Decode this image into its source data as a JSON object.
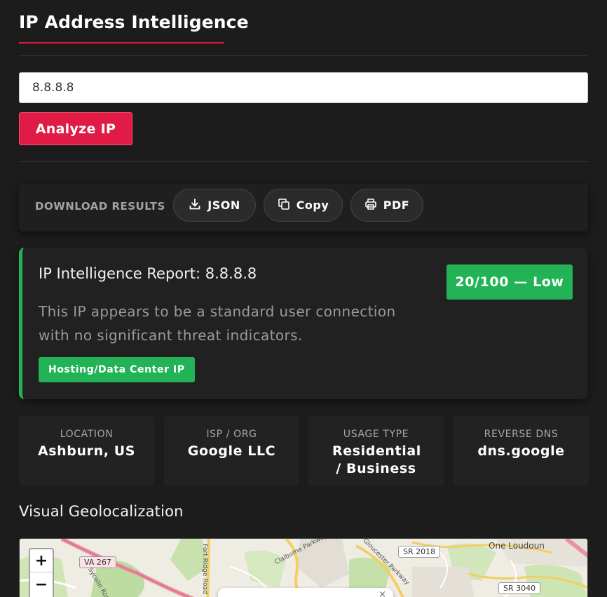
{
  "page": {
    "title": "IP Address Intelligence"
  },
  "search": {
    "value": "8.8.8.8",
    "button_label": "Analyze IP"
  },
  "download": {
    "label": "DOWNLOAD RESULTS",
    "buttons": [
      {
        "label": "JSON",
        "icon": "download-icon"
      },
      {
        "label": "Copy",
        "icon": "copy-icon"
      },
      {
        "label": "PDF",
        "icon": "printer-icon"
      }
    ]
  },
  "report": {
    "title": "IP Intelligence Report: 8.8.8.8",
    "description": "This IP appears to be a standard user connection with no significant threat indicators.",
    "badge": "Hosting/Data Center IP",
    "score": "20/100 — Low",
    "accent_color": "#22b357"
  },
  "stats": [
    {
      "label": "LOCATION",
      "value": "Ashburn, US"
    },
    {
      "label": "ISP / ORG",
      "value": "Google LLC"
    },
    {
      "label": "USAGE TYPE",
      "value": "Residential / Business"
    },
    {
      "label": "REVERSE DNS",
      "value": "dns.google"
    }
  ],
  "geo": {
    "heading": "Visual Geolocalization",
    "zoom_in": "+",
    "zoom_out": "−",
    "labels": {
      "va267": "VA 267",
      "sr2018": "SR 2018",
      "sr3040": "SR 3040",
      "one_loudoun": "One Loudoun",
      "claiborne": "Claiborne Parkway",
      "gloucester": "Gloucester Parkway",
      "fort_ridge": "Fort Ridge Road",
      "sycolin": "Sycolin Road"
    },
    "popup_close": "×"
  },
  "colors": {
    "accent_red": "#e01b45",
    "success_green": "#22b357",
    "background": "#1c1c1c"
  }
}
